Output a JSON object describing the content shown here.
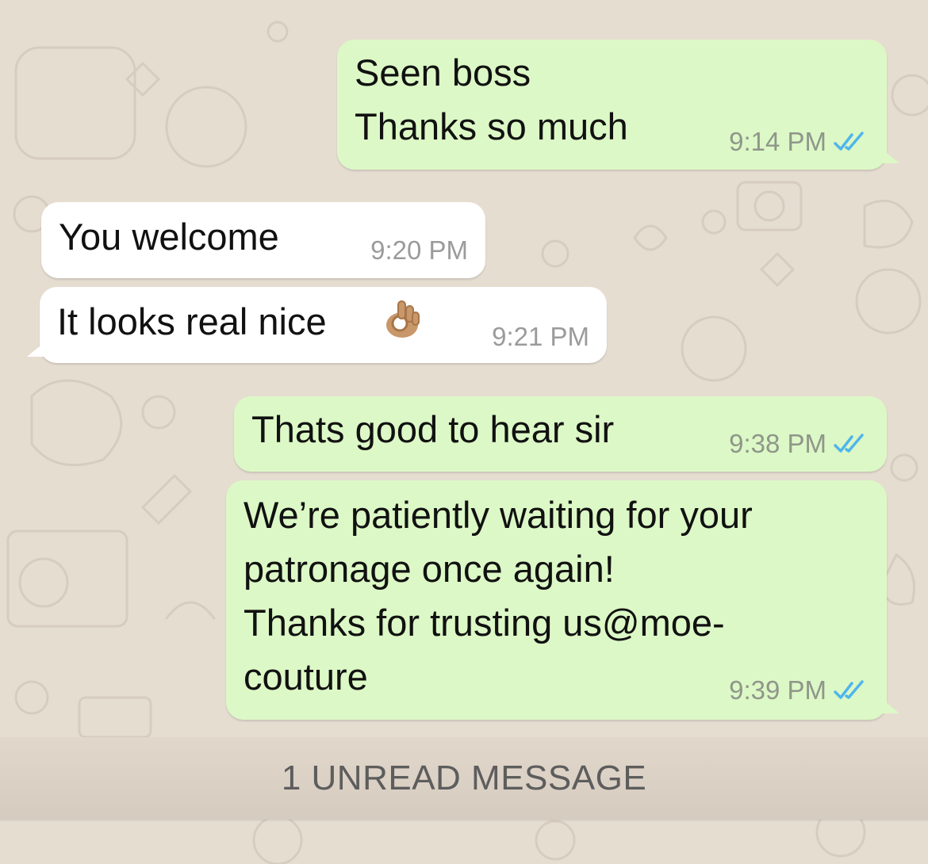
{
  "messages": [
    {
      "dir": "out",
      "text": "Seen boss\nThanks so much",
      "time": "9:14 PM",
      "status": "read"
    },
    {
      "dir": "in",
      "text": "You welcome",
      "time": "9:20 PM"
    },
    {
      "dir": "in",
      "text": "It looks real nice",
      "emoji": "ok-hand",
      "time": "9:21 PM"
    },
    {
      "dir": "out",
      "text": "Thats good to hear sir",
      "time": "9:38 PM",
      "status": "read"
    },
    {
      "dir": "out",
      "text": "We’re patiently waiting for your\npatronage once again!\nThanks for trusting us@moe-\ncouture",
      "time": "9:39 PM",
      "status": "read"
    }
  ],
  "unread_banner": "1 UNREAD MESSAGE",
  "colors": {
    "outgoing_bubble": "#dcf8c6",
    "incoming_bubble": "#ffffff",
    "read_tick": "#4fb6ec",
    "wallpaper": "#e6ddd1"
  },
  "icons": {
    "read_receipt": "double-check-icon",
    "emoji": "ok-hand-emoji"
  }
}
